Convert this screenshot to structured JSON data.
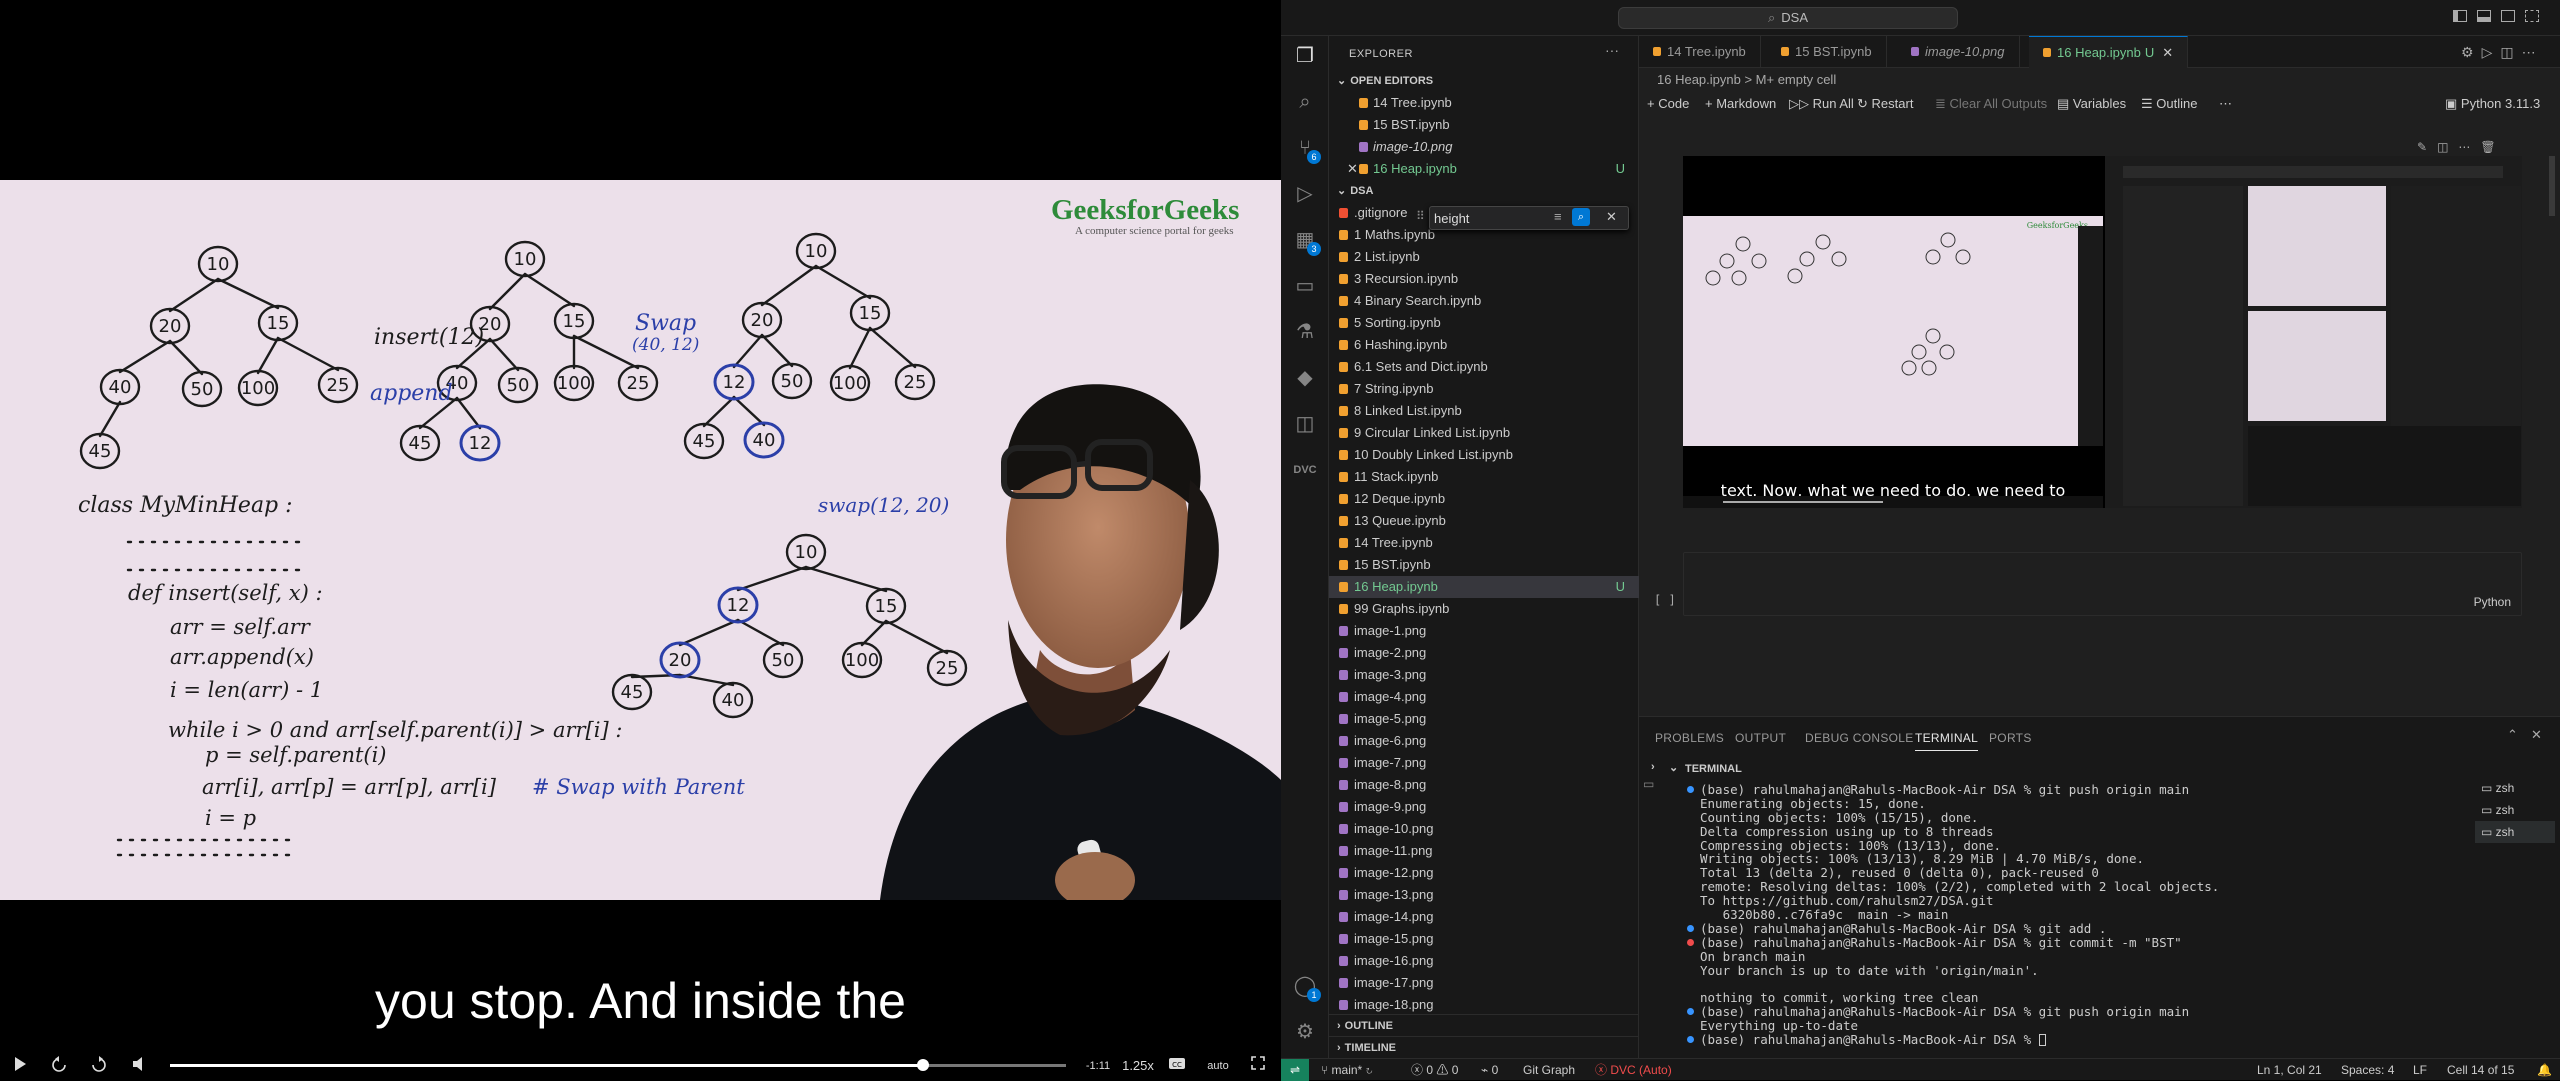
{
  "player": {
    "watermark_title": "GeeksforGeeks",
    "watermark_subtitle": "A computer science portal for geeks",
    "subtitle": "you stop. And inside the",
    "time_remaining": "-1:11",
    "speed": "1.25x",
    "quality": "auto",
    "progress": 0.84,
    "board": {
      "insert_note": "insert(12)",
      "append_note": "append",
      "swap_note_1": "Swap",
      "swap_note_1b": "(40, 12)",
      "swap_note_2": "swap(12, 20)",
      "class_line": "class MyMinHeap :",
      "code": [
        "def insert(self, x) :",
        "arr = self.arr",
        "arr.append(x)",
        "i = len(arr) - 1",
        "while i > 0 and arr[self.parent(i)] > arr[i] :",
        "p = self.parent(i)",
        "arr[i], arr[p] = arr[p], arr[i]",
        "i = p"
      ],
      "swap_comment": "# Swap with Parent",
      "tree1": [
        "10",
        "20",
        "15",
        "40",
        "50",
        "100",
        "25",
        "45"
      ],
      "tree2": [
        "10",
        "20",
        "15",
        "40",
        "50",
        "100",
        "25",
        "45",
        "12"
      ],
      "tree3": [
        "10",
        "20",
        "15",
        "12",
        "50",
        "100",
        "25",
        "45",
        "40"
      ],
      "tree4": [
        "10",
        "12",
        "15",
        "20",
        "50",
        "100",
        "25",
        "45",
        "40"
      ]
    }
  },
  "vscode": {
    "command_center": "DSA",
    "explorer_title": "EXPLORER",
    "open_editors_header": "OPEN EDITORS",
    "open_editors": [
      {
        "name": "14 Tree.ipynb",
        "italic": false,
        "modified": false
      },
      {
        "name": "15 BST.ipynb",
        "italic": false,
        "modified": false
      },
      {
        "name": "image-10.png",
        "italic": true,
        "modified": false
      },
      {
        "name": "16 Heap.ipynb",
        "italic": false,
        "modified": true,
        "badge": "U"
      }
    ],
    "workspace_header": "DSA",
    "files": [
      ".gitignore",
      "1 Maths.ipynb",
      "2 List.ipynb",
      "3 Recursion.ipynb",
      "4 Binary Search.ipynb",
      "5 Sorting.ipynb",
      "6 Hashing.ipynb",
      "6.1 Sets and Dict.ipynb",
      "7 String.ipynb",
      "8 Linked List.ipynb",
      "9 Circular Linked List.ipynb",
      "10 Doubly Linked List.ipynb",
      "11 Stack.ipynb",
      "12 Deque.ipynb",
      "13 Queue.ipynb",
      "14 Tree.ipynb",
      "15 BST.ipynb",
      "16 Heap.ipynb",
      "99 Graphs.ipynb",
      "image-1.png",
      "image-2.png",
      "image-3.png",
      "image-4.png",
      "image-5.png",
      "image-6.png",
      "image-7.png",
      "image-8.png",
      "image-9.png",
      "image-10.png",
      "image-11.png",
      "image-12.png",
      "image-13.png",
      "image-14.png",
      "image-15.png",
      "image-16.png",
      "image-17.png",
      "image-18.png"
    ],
    "selected_file_badge": "U",
    "find_widget_value": "height",
    "outline_header": "OUTLINE",
    "timeline_header": "TIMELINE",
    "tabs": [
      {
        "label": "14 Tree.ipynb"
      },
      {
        "label": "15 BST.ipynb"
      },
      {
        "label": "image-10.png"
      },
      {
        "label": "16 Heap.ipynb",
        "badge": "U"
      }
    ],
    "breadcrumb": "16 Heap.ipynb > M+ empty cell",
    "toolbar": {
      "code": "Code",
      "markdown": "Markdown",
      "run_all": "Run All",
      "restart": "Restart",
      "clear_outputs": "Clear All Outputs",
      "variables": "Variables",
      "outline": "Outline",
      "kernel": "Python 3.11.3"
    },
    "output_caption": "text. Now, what we need to do, we need to",
    "empty_cell_bracket": "[ ]",
    "empty_cell_lang": "Python",
    "panel_tabs": [
      "PROBLEMS",
      "OUTPUT",
      "DEBUG CONSOLE",
      "TERMINAL",
      "PORTS"
    ],
    "terminal_header": "TERMINAL",
    "terminal_lines": [
      {
        "dot": "#3794ff",
        "text": "(base) rahulmahajan@Rahuls-MacBook-Air DSA % git push origin main"
      },
      {
        "dot": "",
        "text": "Enumerating objects: 15, done."
      },
      {
        "dot": "",
        "text": "Counting objects: 100% (15/15), done."
      },
      {
        "dot": "",
        "text": "Delta compression using up to 8 threads"
      },
      {
        "dot": "",
        "text": "Compressing objects: 100% (13/13), done."
      },
      {
        "dot": "",
        "text": "Writing objects: 100% (13/13), 8.29 MiB | 4.70 MiB/s, done."
      },
      {
        "dot": "",
        "text": "Total 13 (delta 2), reused 0 (delta 0), pack-reused 0"
      },
      {
        "dot": "",
        "text": "remote: Resolving deltas: 100% (2/2), completed with 2 local objects."
      },
      {
        "dot": "",
        "text": "To https://github.com/rahulsm27/DSA.git"
      },
      {
        "dot": "",
        "text": "   6320b80..c76fa9c  main -> main"
      },
      {
        "dot": "#3794ff",
        "text": "(base) rahulmahajan@Rahuls-MacBook-Air DSA % git add ."
      },
      {
        "dot": "#f14c4c",
        "text": "(base) rahulmahajan@Rahuls-MacBook-Air DSA % git commit -m \"BST\""
      },
      {
        "dot": "",
        "text": "On branch main"
      },
      {
        "dot": "",
        "text": "Your branch is up to date with 'origin/main'."
      },
      {
        "dot": "",
        "text": ""
      },
      {
        "dot": "",
        "text": "nothing to commit, working tree clean"
      },
      {
        "dot": "#3794ff",
        "text": "(base) rahulmahajan@Rahuls-MacBook-Air DSA % git push origin main"
      },
      {
        "dot": "",
        "text": "Everything up-to-date"
      },
      {
        "dot": "#3794ff",
        "text": "(base) rahulmahajan@Rahuls-MacBook-Air DSA % "
      }
    ],
    "shells": [
      "zsh",
      "zsh",
      "zsh"
    ],
    "status": {
      "branch": "main*",
      "errors": "0",
      "warnings": "0",
      "ports": "0",
      "git_graph": "Git Graph",
      "dvc": "DVC (Auto)",
      "position": "Ln 1, Col 21",
      "spaces": "Spaces: 4",
      "eol": "LF",
      "cell": "Cell 14 of 15"
    },
    "colors": {
      "accent": "#0078d4",
      "untracked": "#73c991",
      "dvc": "#f14c4c"
    }
  }
}
